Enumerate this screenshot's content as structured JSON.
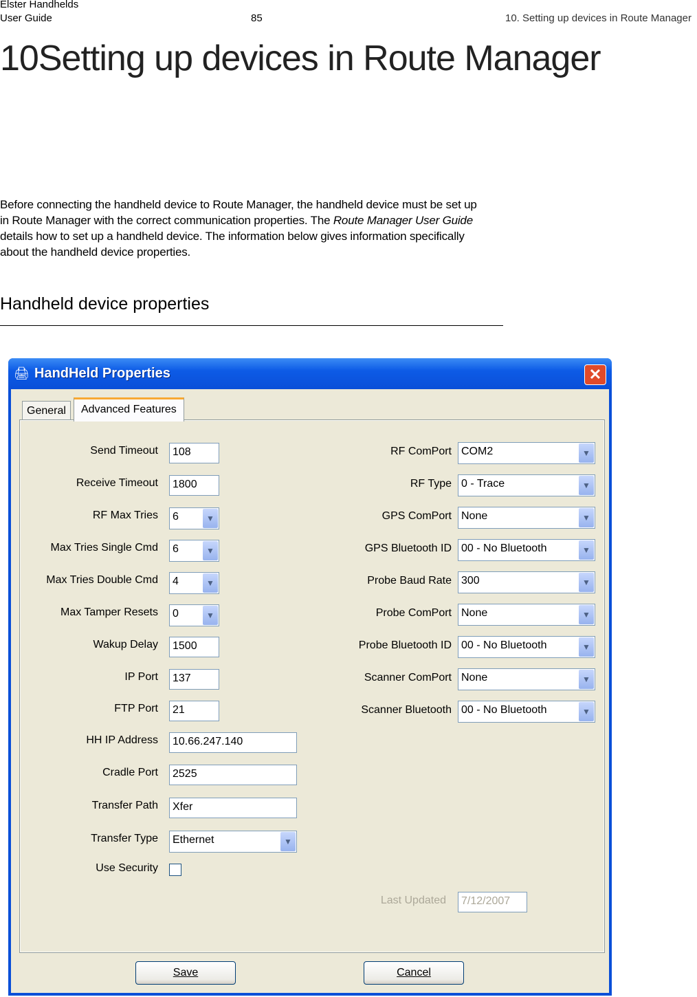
{
  "header": {
    "company": "Elster Handhelds",
    "doc": "User Guide",
    "page": "85",
    "chapter": "10. Setting up devices in Route Manager"
  },
  "title": {
    "number": "10",
    "text": "Setting up devices in Route Manager"
  },
  "intro": {
    "before": "Before connecting the handheld device to Route Manager, the handheld device must be set up in Route Manager with the correct communication properties. The ",
    "italic": "Route Manager User Guide",
    "after": " details how to set up a handheld device. The information below gives information specifically about the handheld device properties."
  },
  "section_heading": "Handheld device properties",
  "dialog": {
    "title": "HandHeld Properties",
    "close_label": "✕",
    "tabs": [
      {
        "label": "General",
        "active": false
      },
      {
        "label": "Advanced Features",
        "active": true
      }
    ],
    "left_fields": [
      {
        "label": "Send Timeout",
        "value": "108",
        "type": "text",
        "width": "small"
      },
      {
        "label": "Receive Timeout",
        "value": "1800",
        "type": "text",
        "width": "small"
      },
      {
        "label": "RF Max Tries",
        "value": "6",
        "type": "select",
        "width": "small"
      },
      {
        "label": "Max Tries Single Cmd",
        "value": "6",
        "type": "select",
        "width": "small"
      },
      {
        "label": "Max Tries Double Cmd",
        "value": "4",
        "type": "select",
        "width": "small"
      },
      {
        "label": "Max Tamper Resets",
        "value": "0",
        "type": "select",
        "width": "small"
      },
      {
        "label": "Wakup Delay",
        "value": "1500",
        "type": "text",
        "width": "small"
      },
      {
        "label": "IP Port",
        "value": "137",
        "type": "text",
        "width": "small"
      },
      {
        "label": "FTP Port",
        "value": "21",
        "type": "text",
        "width": "small"
      },
      {
        "label": "HH IP Address",
        "value": "10.66.247.140",
        "type": "text",
        "width": "wide"
      },
      {
        "label": "Cradle Port",
        "value": "2525",
        "type": "text",
        "width": "wide"
      },
      {
        "label": "Transfer Path",
        "value": "Xfer",
        "type": "text",
        "width": "wide"
      },
      {
        "label": "Transfer Type",
        "value": "Ethernet",
        "type": "select",
        "width": "wide"
      },
      {
        "label": "Use Security",
        "value": "",
        "type": "checkbox",
        "checked": false
      }
    ],
    "right_fields": [
      {
        "label": "RF ComPort",
        "value": "COM2"
      },
      {
        "label": "RF Type",
        "value": "0 - Trace"
      },
      {
        "label": "GPS ComPort",
        "value": "None"
      },
      {
        "label": "GPS Bluetooth ID",
        "value": "00 - No Bluetooth"
      },
      {
        "label": "Probe Baud Rate",
        "value": "300"
      },
      {
        "label": "Probe ComPort",
        "value": "None"
      },
      {
        "label": "Probe Bluetooth ID",
        "value": "00 - No Bluetooth"
      },
      {
        "label": "Scanner ComPort",
        "value": "None"
      },
      {
        "label": "Scanner Bluetooth",
        "value": "00 - No Bluetooth"
      }
    ],
    "last_updated": {
      "label": "Last Updated",
      "value": "7/12/2007"
    },
    "save_label": "Save",
    "cancel_label": "Cancel",
    "colors": {
      "titlebar": "#0a4fd8",
      "face": "#ece9d8",
      "tab_highlight": "#f8a832"
    }
  }
}
